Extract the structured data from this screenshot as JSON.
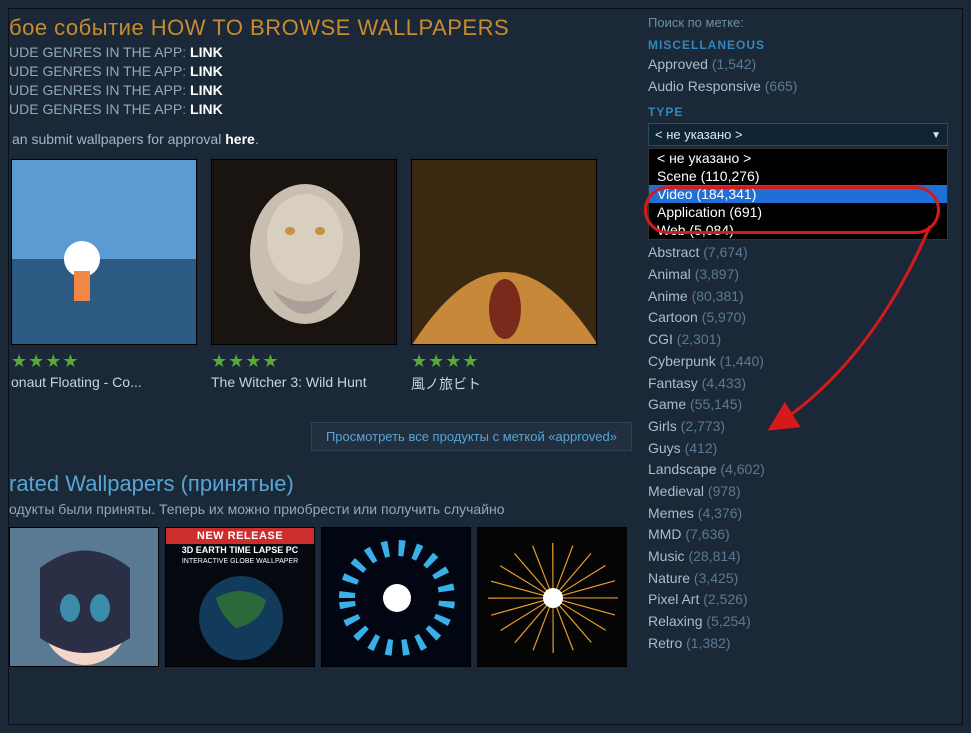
{
  "header": {
    "title_prefix": "бое событие ",
    "title_main": "HOW TO BROWSE WALLPAPERS",
    "genre_prefix": "UDE GENRES IN THE APP",
    "genre_link": "LINK",
    "submit_prefix": "an submit wallpapers for approval ",
    "submit_link": "here"
  },
  "thumbs": [
    {
      "title": "onaut Floating - Co...",
      "stars": "★★★★",
      "art": "astronaut"
    },
    {
      "title": "The Witcher 3: Wild Hunt",
      "stars": "★★★★",
      "art": "witcher"
    },
    {
      "title": "風ノ旅ビト",
      "stars": "★★★★",
      "art": "journey"
    }
  ],
  "view_all": "Просмотреть все продукты с меткой «approved»",
  "rated": {
    "title": "rated Wallpapers (принятые)",
    "sub": "одукты были приняты. Теперь их можно приобрести или получить случайно"
  },
  "wp_row": [
    {
      "badge": "",
      "kind": "anime"
    },
    {
      "badge": "NEW RELEASE",
      "sub1": "3D EARTH TIME LAPSE PC",
      "sub2": "INTERACTIVE GLOBE WALLPAPER",
      "kind": "earth"
    },
    {
      "badge": "",
      "kind": "vortex"
    },
    {
      "badge": "",
      "kind": "particle"
    }
  ],
  "sidebar": {
    "search_label": "Поиск по метке:",
    "misc_head": "MISCELLANEOUS",
    "misc": [
      {
        "label": "Approved",
        "count": "(1,542)"
      },
      {
        "label": "Audio Responsive",
        "count": "(665)"
      }
    ],
    "type_head": "TYPE",
    "type_selected": "< не указано >",
    "type_options": [
      {
        "label": "< не указано >",
        "highlight": false
      },
      {
        "label": "Scene (110,276)",
        "highlight": false
      },
      {
        "label": "Video (184,341)",
        "highlight": true
      },
      {
        "label": "Application (691)",
        "highlight": false
      },
      {
        "label": "Web (5,084)",
        "highlight": false
      }
    ],
    "genres_head": "",
    "genres": [
      {
        "label": "Abstract",
        "count": "(7,674)"
      },
      {
        "label": "Animal",
        "count": "(3,897)"
      },
      {
        "label": "Anime",
        "count": "(80,381)"
      },
      {
        "label": "Cartoon",
        "count": "(5,970)"
      },
      {
        "label": "CGI",
        "count": "(2,301)"
      },
      {
        "label": "Cyberpunk",
        "count": "(1,440)"
      },
      {
        "label": "Fantasy",
        "count": "(4,433)"
      },
      {
        "label": "Game",
        "count": "(55,145)"
      },
      {
        "label": "Girls",
        "count": "(2,773)"
      },
      {
        "label": "Guys",
        "count": "(412)"
      },
      {
        "label": "Landscape",
        "count": "(4,602)"
      },
      {
        "label": "Medieval",
        "count": "(978)"
      },
      {
        "label": "Memes",
        "count": "(4,376)"
      },
      {
        "label": "MMD",
        "count": "(7,636)"
      },
      {
        "label": "Music",
        "count": "(28,814)"
      },
      {
        "label": "Nature",
        "count": "(3,425)"
      },
      {
        "label": "Pixel Art",
        "count": "(2,526)"
      },
      {
        "label": "Relaxing",
        "count": "(5,254)"
      },
      {
        "label": "Retro",
        "count": "(1,382)"
      }
    ]
  }
}
